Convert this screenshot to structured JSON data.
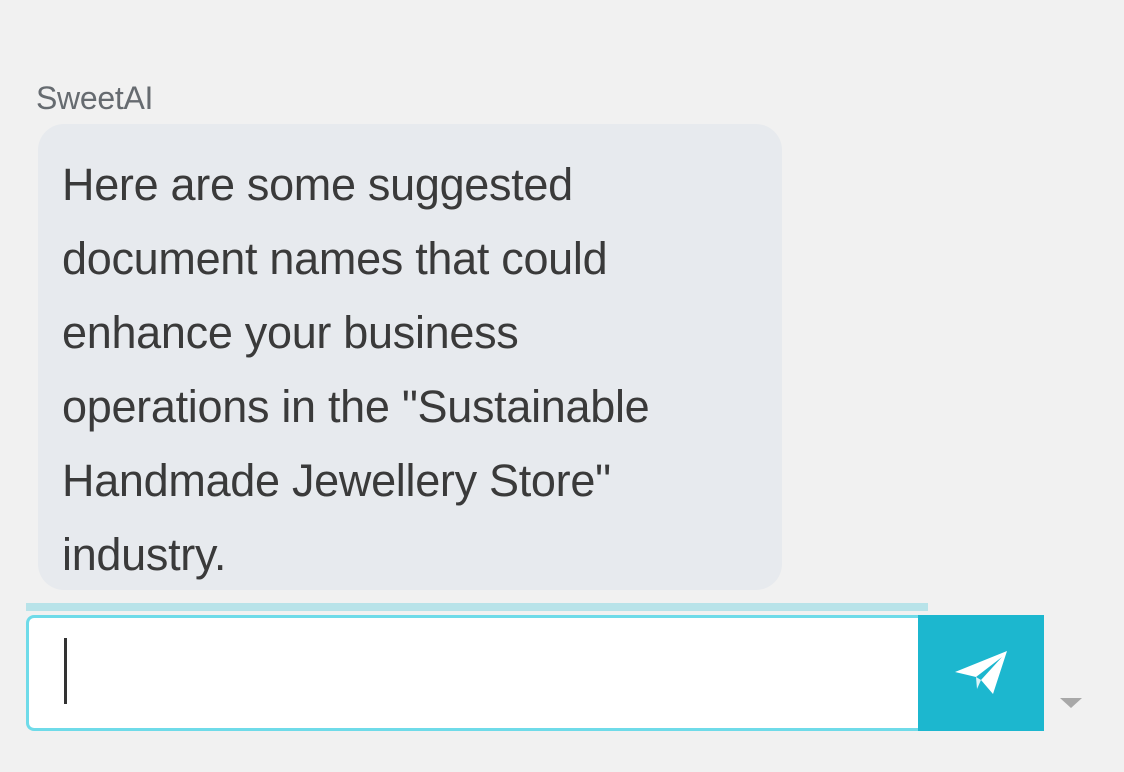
{
  "message": {
    "sender": "SweetAI",
    "text": "Here are some suggested\ndocument names that could\nenhance your business\noperations in the \"Sustainable\nHandmade Jewellery Store\"\nindustry."
  },
  "composer": {
    "input_value": "",
    "send_icon": "paper-plane-icon",
    "dropdown_icon": "caret-down-icon"
  },
  "colors": {
    "background": "#f1f1f1",
    "bubble": "#e7eaee",
    "accent": "#1cb7cf",
    "input_border": "#6fdbe9"
  }
}
